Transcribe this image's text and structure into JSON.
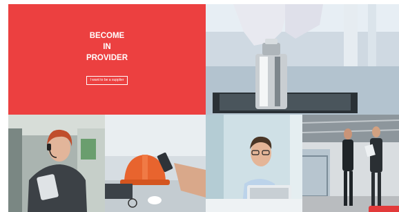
{
  "hero": {
    "title_lines": [
      "BECOME",
      "IN",
      "PROVIDER"
    ],
    "cta_label": "I want to be a supplier"
  },
  "tiles": [
    {
      "icon": "precision-weight-photo"
    },
    {
      "icon": "call-center-worker-photo"
    },
    {
      "icon": "hard-hat-desk-photo"
    },
    {
      "icon": "man-with-laptop-photo"
    },
    {
      "icon": "warehouse-workers-photo"
    }
  ],
  "colors": {
    "accent": "#ec4040",
    "badge": "#e23a3a"
  },
  "chat_badge": {
    "label": ""
  }
}
